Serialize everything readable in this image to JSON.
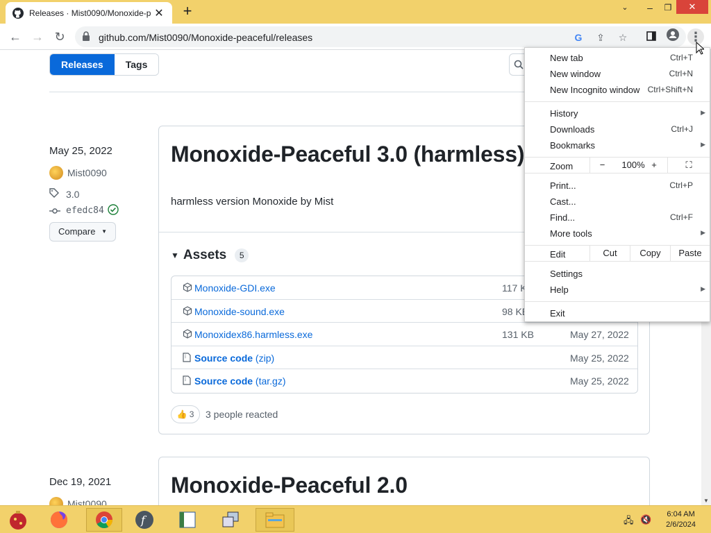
{
  "browser": {
    "tab_title": "Releases · Mist0090/Monoxide-p",
    "url": "github.com/Mist0090/Monoxide-peaceful/releases"
  },
  "page": {
    "segment": [
      "Releases",
      "Tags"
    ],
    "release1": {
      "date": "May 25, 2022",
      "author": "Mist0090",
      "tag": "3.0",
      "commit": "efedc84",
      "compare_label": "Compare",
      "title": "Monoxide-Peaceful 3.0 (harmless)",
      "body": "harmless version Monoxide by Mist",
      "assets_label": "Assets",
      "assets_count": "5",
      "assets": [
        {
          "name": "Monoxide-GDI.exe",
          "suffix": "",
          "size": "117 K",
          "date": ""
        },
        {
          "name": "Monoxide-sound.exe",
          "suffix": "",
          "size": "98 KB",
          "date": ""
        },
        {
          "name": "Monoxidex86.harmless.exe",
          "suffix": "",
          "size": "131 KB",
          "date": "May 27, 2022"
        },
        {
          "name": "Source code",
          "suffix": " (zip)",
          "size": "",
          "date": "May 25, 2022"
        },
        {
          "name": "Source code",
          "suffix": " (tar.gz)",
          "size": "",
          "date": "May 25, 2022"
        }
      ],
      "reaction_count": "3",
      "reaction_text": "3 people reacted"
    },
    "release2": {
      "date": "Dec 19, 2021",
      "author": "Mist0090",
      "title": "Monoxide-Peaceful 2.0"
    }
  },
  "menu": {
    "new_tab": "New tab",
    "new_tab_sc": "Ctrl+T",
    "new_window": "New window",
    "new_window_sc": "Ctrl+N",
    "incognito": "New Incognito window",
    "incognito_sc": "Ctrl+Shift+N",
    "history": "History",
    "downloads": "Downloads",
    "downloads_sc": "Ctrl+J",
    "bookmarks": "Bookmarks",
    "zoom": "Zoom",
    "zoom_minus": "−",
    "zoom_value": "100%",
    "zoom_plus": "+",
    "print": "Print...",
    "print_sc": "Ctrl+P",
    "cast": "Cast...",
    "find": "Find...",
    "find_sc": "Ctrl+F",
    "more_tools": "More tools",
    "edit": "Edit",
    "cut": "Cut",
    "copy": "Copy",
    "paste": "Paste",
    "settings": "Settings",
    "help": "Help",
    "exit": "Exit"
  },
  "taskbar": {
    "time": "6:04 AM",
    "date": "2/6/2024"
  },
  "colors": {
    "accent": "#0969da",
    "chrome_frame": "#f2d16b"
  }
}
